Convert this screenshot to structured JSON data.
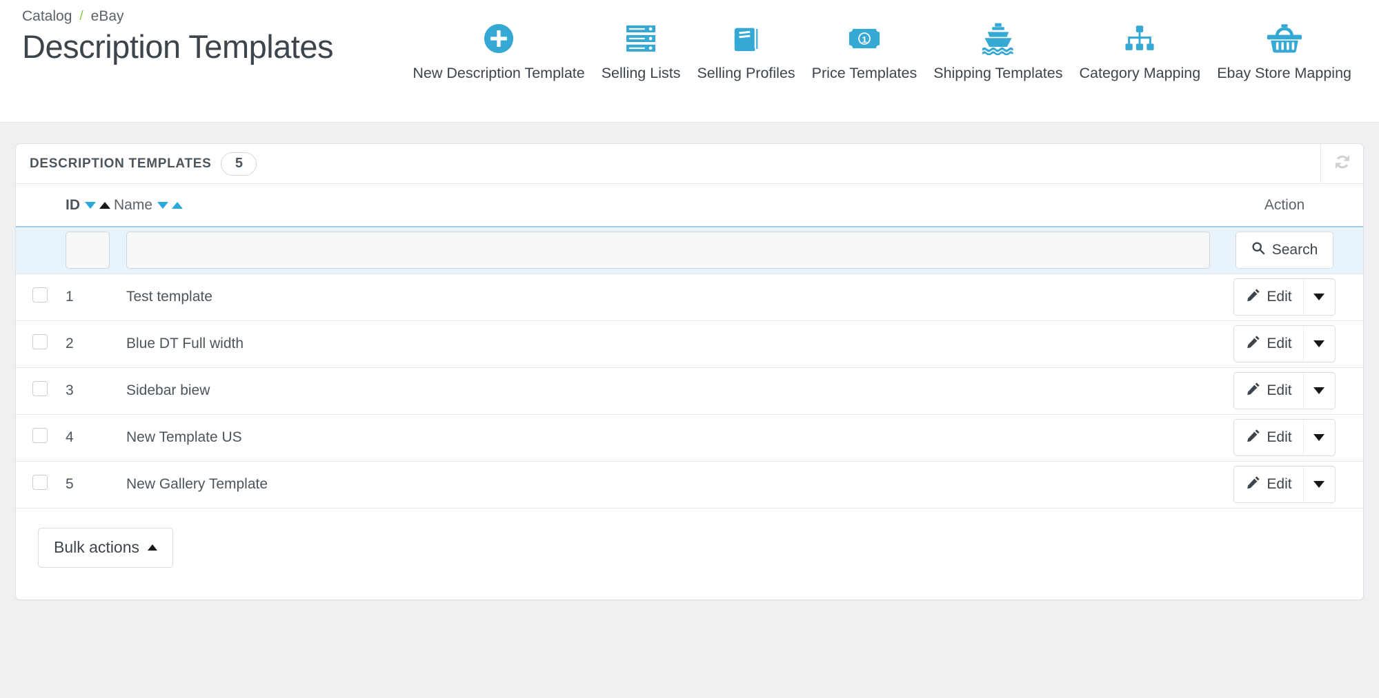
{
  "breadcrumb": {
    "items": [
      {
        "label": "Catalog"
      },
      {
        "label": "eBay"
      }
    ],
    "separator": "/"
  },
  "header": {
    "title": "Description Templates"
  },
  "toolbar": {
    "items": [
      {
        "label": "New Description Template",
        "icon": "plus-circle-icon"
      },
      {
        "label": "Selling Lists",
        "icon": "server-list-icon"
      },
      {
        "label": "Selling Profiles",
        "icon": "book-icon"
      },
      {
        "label": "Price Templates",
        "icon": "banknote-icon"
      },
      {
        "label": "Shipping Templates",
        "icon": "ship-icon"
      },
      {
        "label": "Category Mapping",
        "icon": "sitemap-icon"
      },
      {
        "label": "Ebay Store Mapping",
        "icon": "basket-icon"
      }
    ]
  },
  "panel": {
    "title": "DESCRIPTION TEMPLATES",
    "count": "5",
    "refresh_icon": "refresh-icon"
  },
  "table": {
    "columns": {
      "id": "ID",
      "name": "Name",
      "action": "Action"
    },
    "sort": {
      "id_active": "asc",
      "name_active": "none"
    },
    "filters": {
      "id_value": "",
      "id_placeholder": "",
      "name_value": "",
      "name_placeholder": "",
      "search_label": "Search",
      "search_icon": "search-icon"
    },
    "rows": [
      {
        "checked": false,
        "id": "1",
        "name": "Test template",
        "action_label": "Edit",
        "action_icon": "pencil-icon"
      },
      {
        "checked": false,
        "id": "2",
        "name": "Blue DT Full width",
        "action_label": "Edit",
        "action_icon": "pencil-icon"
      },
      {
        "checked": false,
        "id": "3",
        "name": "Sidebar biew",
        "action_label": "Edit",
        "action_icon": "pencil-icon"
      },
      {
        "checked": false,
        "id": "4",
        "name": "New Template US",
        "action_label": "Edit",
        "action_icon": "pencil-icon"
      },
      {
        "checked": false,
        "id": "5",
        "name": "New Gallery Template",
        "action_label": "Edit",
        "action_icon": "pencil-icon"
      }
    ]
  },
  "footer": {
    "bulk_actions_label": "Bulk actions",
    "bulk_actions_caret": "caret-up-icon"
  },
  "colors": {
    "accent": "#35a8d4",
    "sort_blue": "#29a8dd",
    "breadcrumb_sep": "#88c43f",
    "text": "#4c545c",
    "page_bg": "#eff0f2",
    "filter_row_bg": "#e9f3fb"
  }
}
